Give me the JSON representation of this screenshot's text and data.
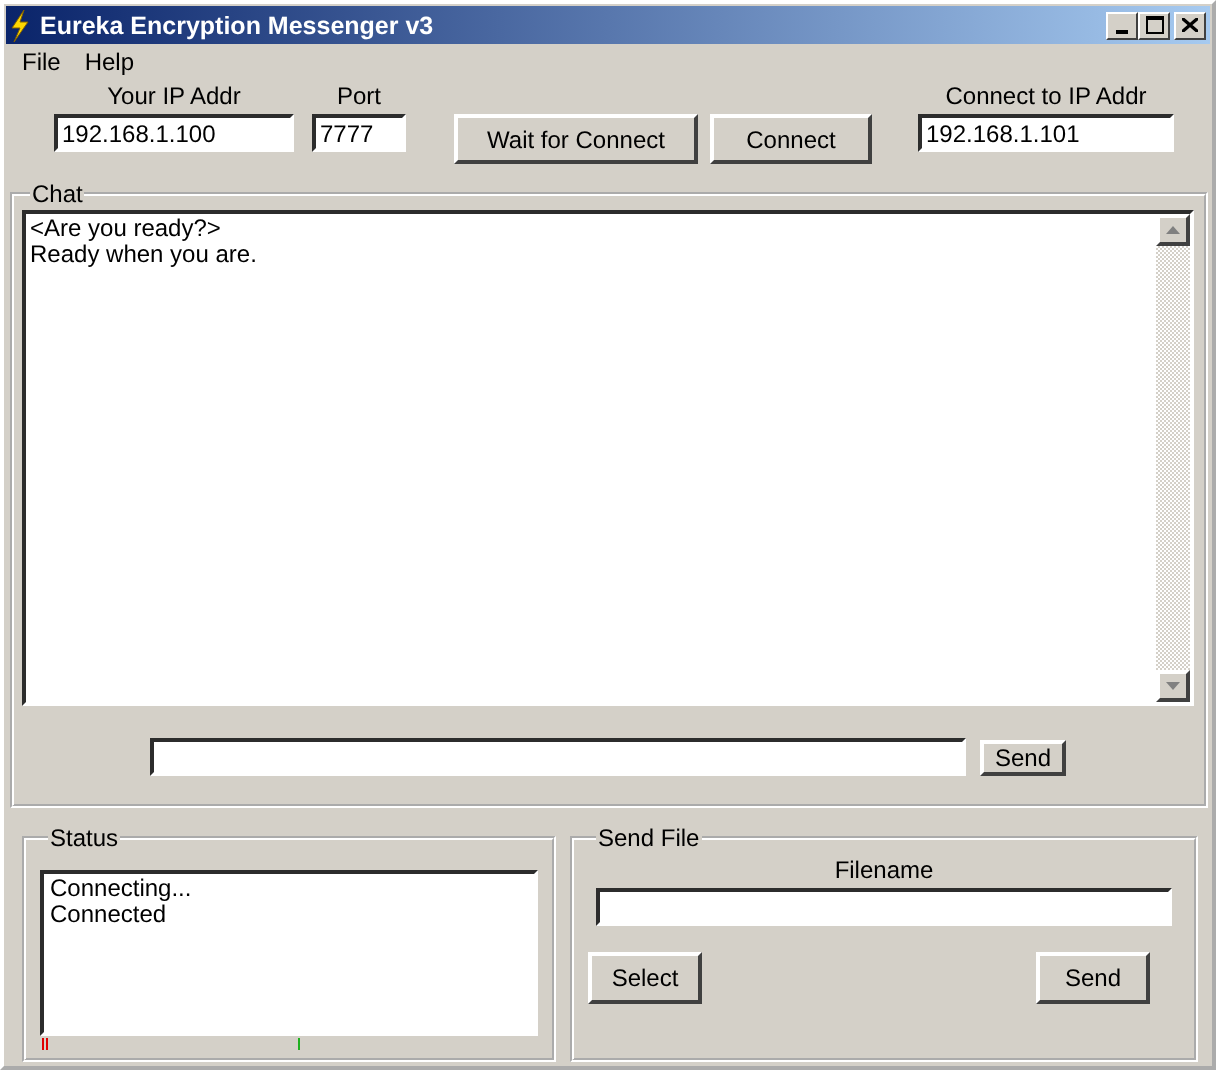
{
  "window": {
    "title": "Eureka Encryption Messenger v3"
  },
  "menu": [
    "File",
    "Help"
  ],
  "connection": {
    "your_ip_label": "Your IP Addr",
    "your_ip": "192.168.1.100",
    "port_label": "Port",
    "port": "7777",
    "wait_button": "Wait for Connect",
    "connect_button": "Connect",
    "remote_ip_label": "Connect to IP Addr",
    "remote_ip": "192.168.1.101"
  },
  "chat": {
    "legend": "Chat",
    "messages": [
      "<Are you ready?>",
      "Ready when you are."
    ],
    "send_button": "Send"
  },
  "status": {
    "legend": "Status",
    "lines": [
      "Connecting...",
      "Connected"
    ]
  },
  "send_file": {
    "legend": "Send File",
    "filename_label": "Filename",
    "select_button": "Select",
    "send_button": "Send"
  }
}
